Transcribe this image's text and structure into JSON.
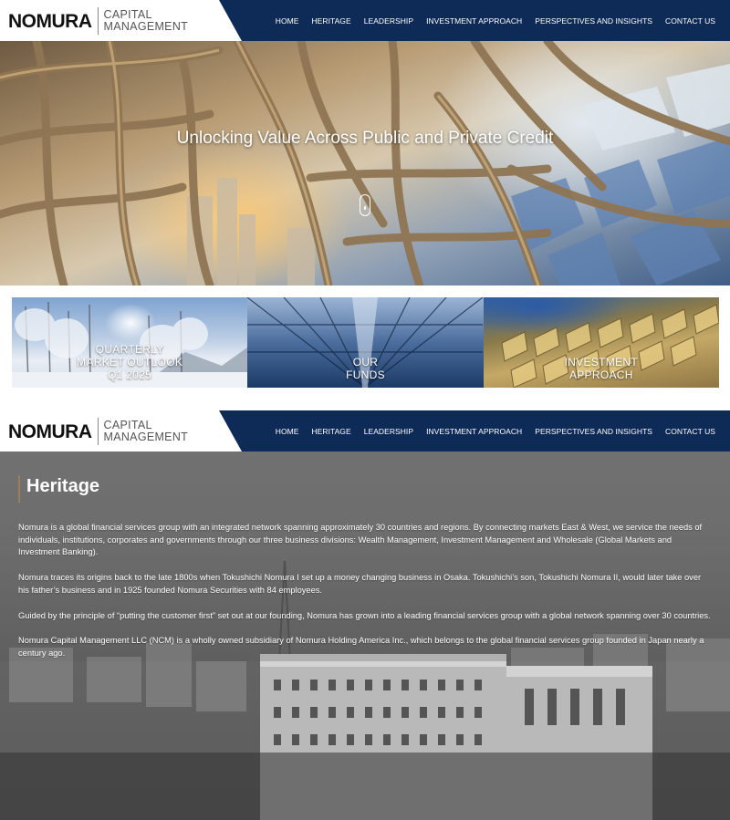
{
  "brand": {
    "name": "NOMURA",
    "sub_line_1": "CAPITAL",
    "sub_line_2": "MANAGEMENT",
    "nav_color": "#0e2a57"
  },
  "nav": {
    "items": [
      {
        "label": "HOME"
      },
      {
        "label": "HERITAGE"
      },
      {
        "label": "LEADERSHIP"
      },
      {
        "label": "INVESTMENT APPROACH"
      },
      {
        "label": "PERSPECTIVES AND INSIGHTS"
      },
      {
        "label": "CONTACT US"
      }
    ]
  },
  "hero": {
    "title": "Unlocking Value Across Public and Private Credit",
    "scroll_icon": "mouse-scroll-icon"
  },
  "tiles": [
    {
      "label": "QUARTERLY\nMARKET OUTLOOK\nQ1 2025"
    },
    {
      "label": "OUR\nFUNDS"
    },
    {
      "label": "INVESTMENT\nAPPROACH"
    }
  ],
  "heritage": {
    "title": "Heritage",
    "accent_color": "#9a7f57",
    "paragraphs": [
      "Nomura is a global financial services group with an integrated network spanning approximately 30 countries and regions. By connecting markets East & West, we service the needs of individuals, institutions, corporates and governments through our three business divisions: Wealth Management, Investment Management and Wholesale (Global Markets and Investment Banking).",
      "Nomura traces its origins back to the late 1800s when Tokushichi Nomura I set up a money changing business in Osaka. Tokushichi’s son, Tokushichi Nomura II, would later take over his father’s business and in 1925 founded Nomura Securities with 84 employees.",
      "Guided by the principle of “putting the customer first” set out at our founding, Nomura has grown into a leading financial services group with a global network spanning over 30 countries.",
      "Nomura Capital Management LLC (NCM) is a wholly owned subsidiary of Nomura Holding America Inc., which belongs to the global financial services group founded in Japan nearly a century ago."
    ]
  }
}
